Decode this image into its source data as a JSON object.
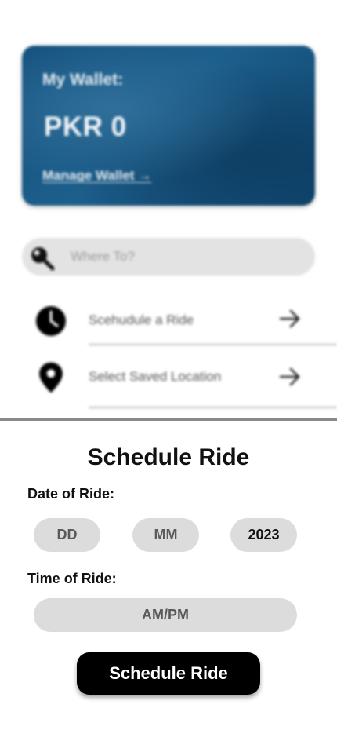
{
  "wallet": {
    "label": "My Wallet:",
    "amount": "PKR 0",
    "manage_link": "Manage Wallet →"
  },
  "search": {
    "placeholder": "Where To?"
  },
  "menu": {
    "items": [
      {
        "label": "Scehudule a Ride",
        "icon": "clock-icon"
      },
      {
        "label": "Select Saved Location",
        "icon": "location-pin-icon"
      }
    ]
  },
  "schedule": {
    "title": "Schedule Ride",
    "date_label": "Date of Ride:",
    "day_placeholder": "DD",
    "month_placeholder": "MM",
    "year_value": "2023",
    "time_label": "Time of Ride:",
    "time_placeholder": "AM/PM",
    "submit_label": "Schedule Ride"
  },
  "colors": {
    "wallet_card": "#1d5f8c",
    "button": "#000000",
    "pill": "#dcdcdc"
  }
}
